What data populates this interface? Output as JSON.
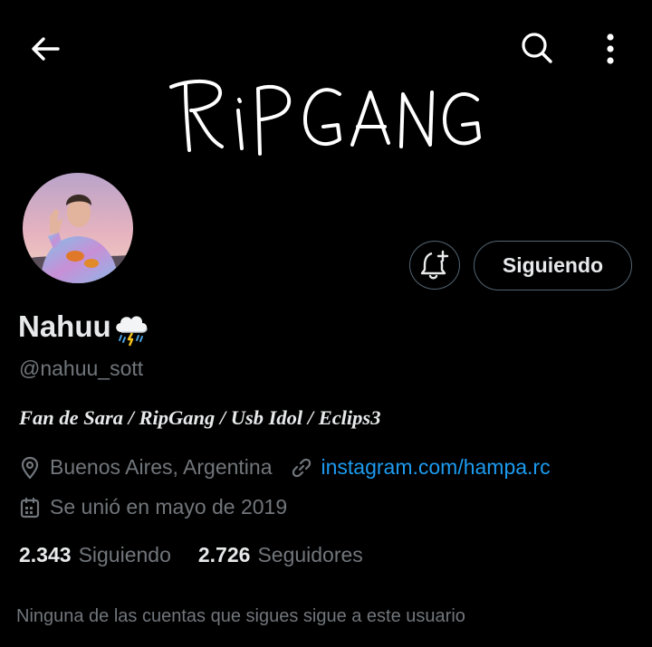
{
  "header": {
    "back_icon": "arrow-left-icon",
    "search_icon": "search-icon",
    "more_icon": "more-vertical-icon"
  },
  "banner": {
    "text": "RIPGANG"
  },
  "profile": {
    "display_name": "Nahuu",
    "name_emoji": "cloud-with-rain-and-lightning",
    "handle": "@nahuu_sott",
    "bio": "Fan de Sara / RipGang / Usb Idol / Eclips3",
    "location": "Buenos Aires, Argentina",
    "website": "instagram.com/hampa.rc",
    "joined": "Se unió en mayo de 2019"
  },
  "actions": {
    "notify_icon": "bell-plus-icon",
    "following_label": "Siguiendo"
  },
  "stats": {
    "following_count": "2.343",
    "following_label": "Siguiendo",
    "followers_count": "2.726",
    "followers_label": "Seguidores"
  },
  "mutuals": {
    "text": "Ninguna de las cuentas que sigues sigue a este usuario"
  },
  "colors": {
    "background": "#000000",
    "text_primary": "#e7e9ea",
    "text_secondary": "#71767b",
    "link": "#1d9bf0",
    "border": "#536471"
  }
}
